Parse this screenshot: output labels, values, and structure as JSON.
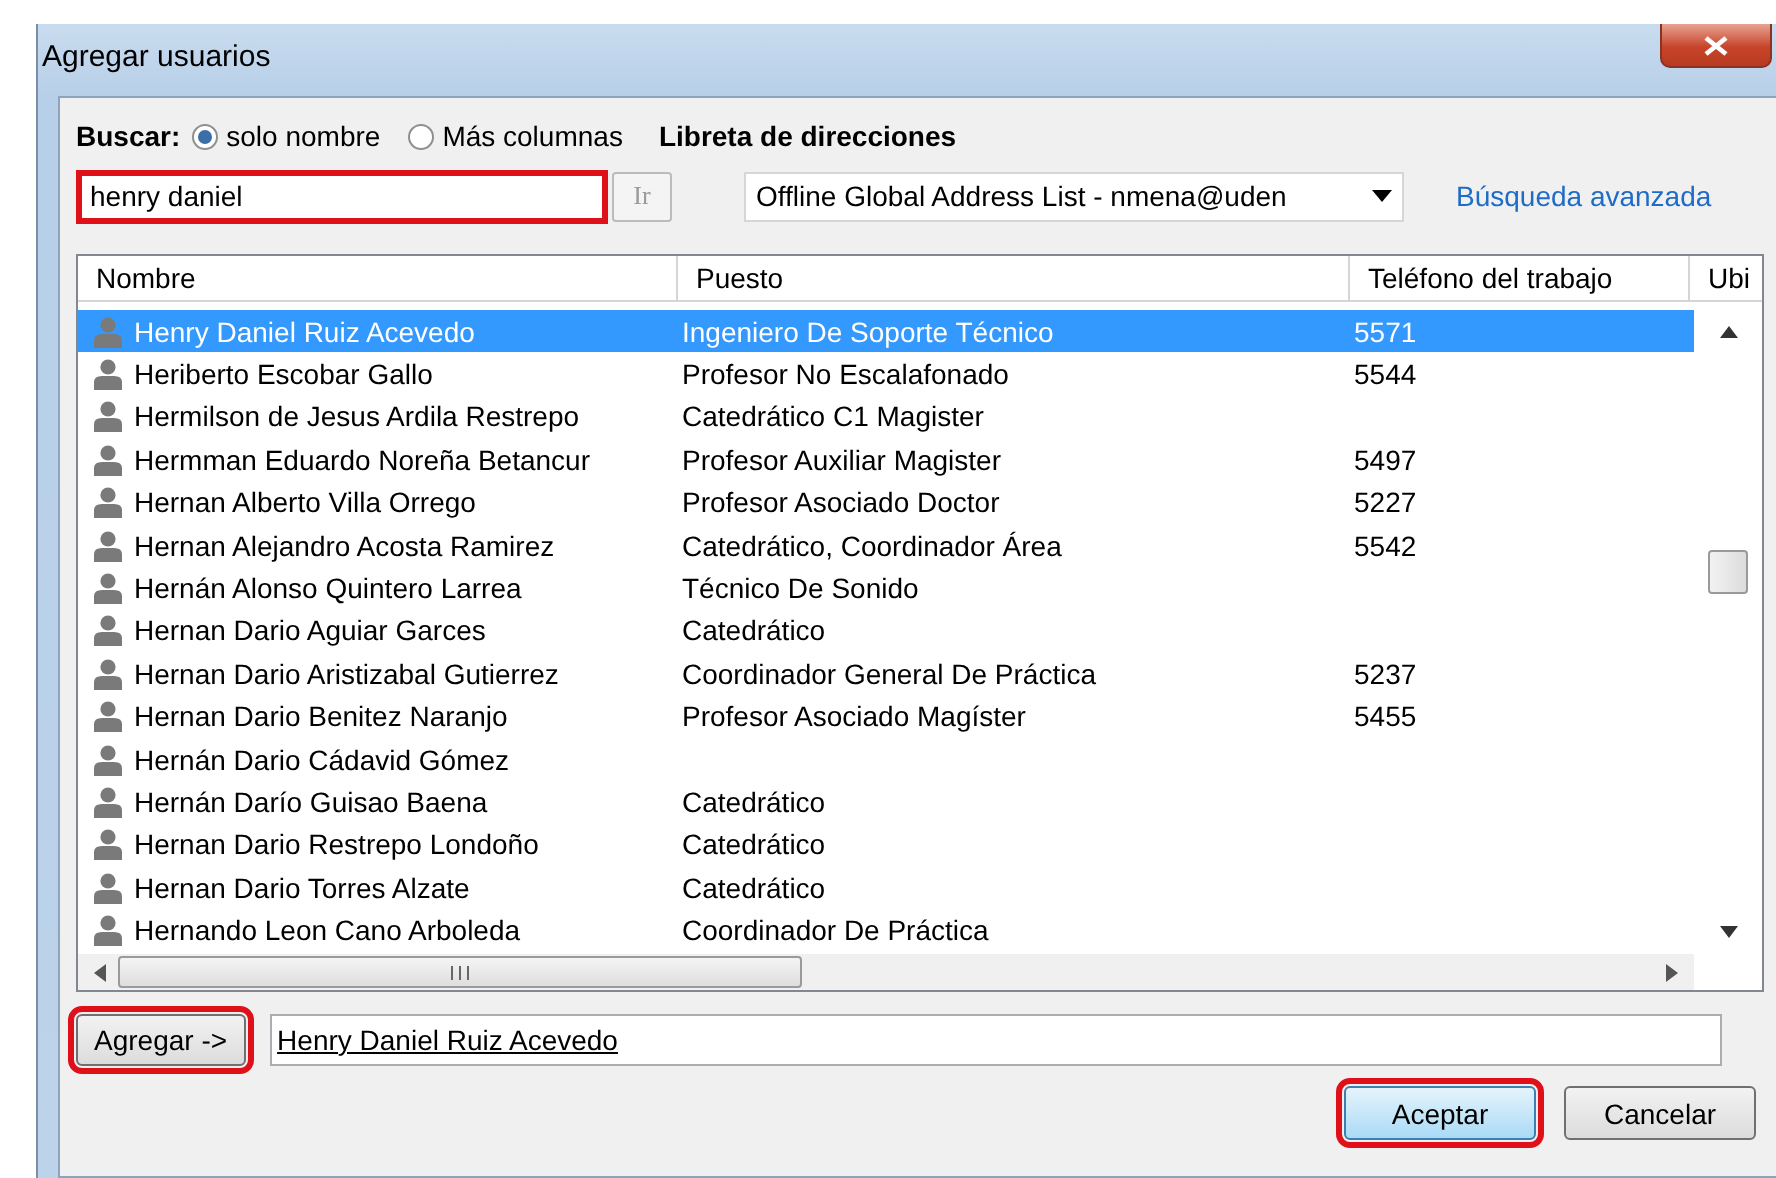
{
  "window": {
    "title": "Agregar usuarios"
  },
  "search": {
    "label": "Buscar:",
    "options": [
      {
        "label": "solo nombre",
        "selected": true
      },
      {
        "label": "Más columnas",
        "selected": false
      }
    ],
    "value": "henry daniel",
    "highlighted": true,
    "go_button": {
      "label": "Ir",
      "disabled": true
    }
  },
  "address_book": {
    "label": "Libreta de direcciones",
    "value": "Offline Global Address List - nmena@uden"
  },
  "advanced_link": "Búsqueda avanzada",
  "table": {
    "columns": [
      "Nombre",
      "Puesto",
      "Teléfono del trabajo",
      "Ubi"
    ],
    "rows": [
      {
        "name": "Henry Daniel Ruiz Acevedo",
        "title": "Ingeniero De Soporte Técnico",
        "phone": "5571",
        "selected": true
      },
      {
        "name": "Heriberto Escobar Gallo",
        "title": "Profesor No Escalafonado",
        "phone": "5544",
        "selected": false
      },
      {
        "name": "Hermilson de Jesus Ardila Restrepo",
        "title": "Catedrático C1 Magister",
        "selected": false
      },
      {
        "name": "Hermman Eduardo Noreña Betancur",
        "title": "Profesor Auxiliar Magister",
        "phone": "5497",
        "selected": false
      },
      {
        "name": "Hernan Alberto Villa Orrego",
        "title": "Profesor Asociado Doctor",
        "phone": "5227",
        "selected": false
      },
      {
        "name": "Hernan Alejandro Acosta Ramirez",
        "title": "Catedrático, Coordinador Área",
        "phone": "5542",
        "selected": false
      },
      {
        "name": "Hernán Alonso Quintero Larrea",
        "title": "Técnico De Sonido",
        "selected": false
      },
      {
        "name": "Hernan Dario Aguiar Garces",
        "title": "Catedrático",
        "selected": false
      },
      {
        "name": "Hernan Dario Aristizabal Gutierrez",
        "title": "Coordinador General De Práctica",
        "phone": "5237",
        "selected": false
      },
      {
        "name": "Hernan Dario Benitez Naranjo",
        "title": "Profesor Asociado Magíster",
        "phone": "5455",
        "selected": false
      },
      {
        "name": "Hernán Dario Cádavid Gómez",
        "selected": false
      },
      {
        "name": "Hernán Darío Guisao Baena",
        "title": "Catedrático",
        "selected": false
      },
      {
        "name": "Hernan Dario Restrepo Londoño",
        "title": "Catedrático",
        "selected": false
      },
      {
        "name": "Hernan Dario Torres Alzate",
        "title": "Catedrático",
        "selected": false
      },
      {
        "name": "Hernando Leon Cano Arboleda",
        "title": "Coordinador De Práctica",
        "selected": false
      }
    ]
  },
  "add": {
    "button": {
      "label": "Agregar ->",
      "highlighted": true
    },
    "value": "Henry Daniel Ruiz Acevedo"
  },
  "buttons": [
    {
      "label": "Aceptar",
      "highlighted": true,
      "default": true
    },
    {
      "label": "Cancelar",
      "highlighted": false,
      "default": false
    }
  ]
}
